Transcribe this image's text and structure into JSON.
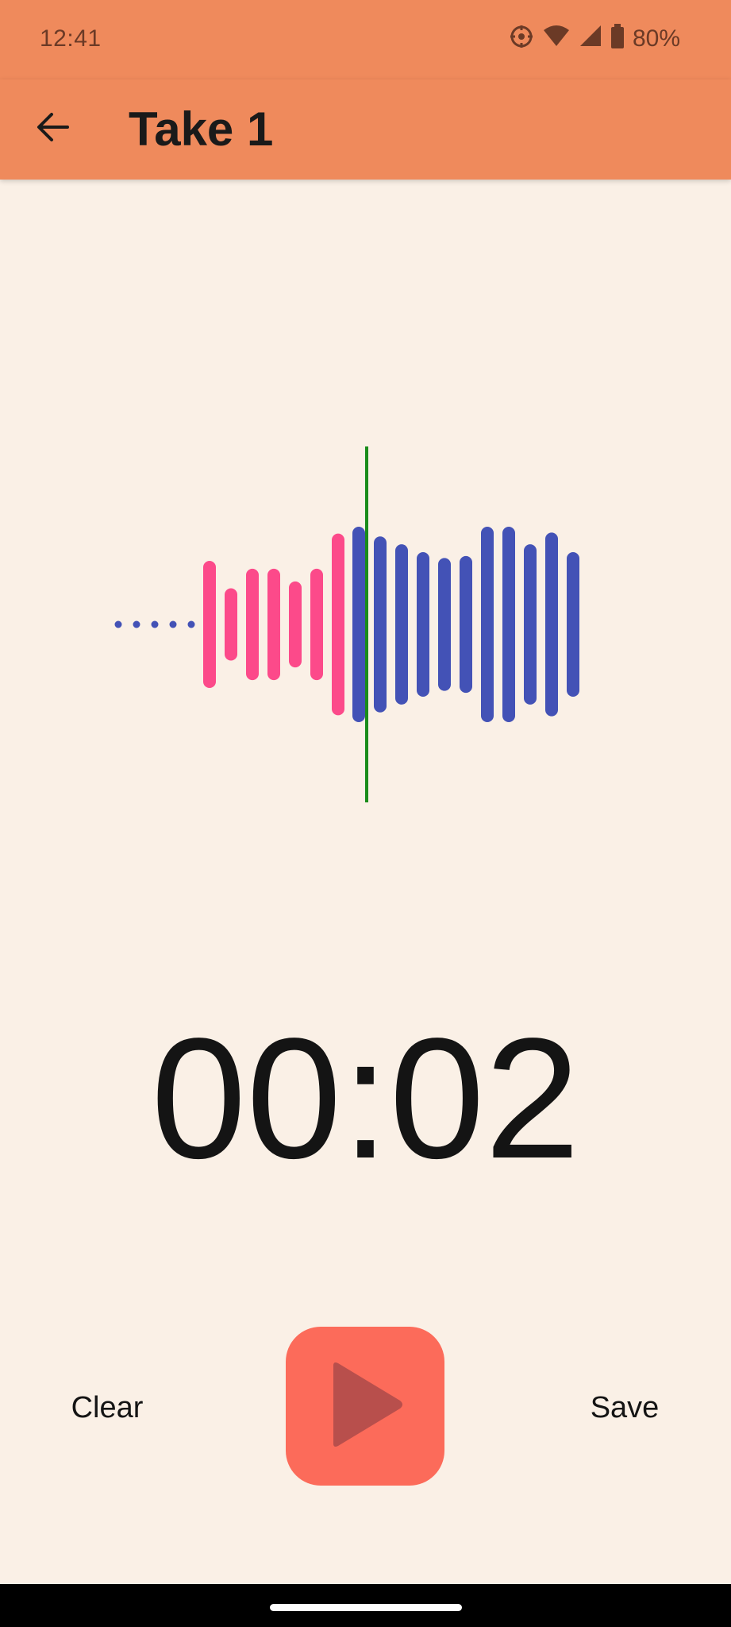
{
  "status_bar": {
    "time": "12:41",
    "battery_percent": "80%",
    "icons": [
      "sync-icon",
      "wifi-icon",
      "cellular-signal-icon",
      "battery-icon"
    ]
  },
  "app_bar": {
    "title": "Take 1",
    "back_icon": "arrow-back-icon"
  },
  "waveform": {
    "played_color": "#fc4a8a",
    "unplayed_color": "#4352b6",
    "playhead_color": "#1a8c1a",
    "played_levels": [
      0.65,
      0.37,
      0.57,
      0.57,
      0.44,
      0.57,
      0.93
    ],
    "unplayed_levels": [
      1.0,
      0.9,
      0.82,
      0.74,
      0.68,
      0.7,
      1.0,
      1.0,
      0.82,
      0.94,
      0.74
    ],
    "leading_dots": 5
  },
  "timer": {
    "elapsed": "00:02"
  },
  "controls": {
    "clear_label": "Clear",
    "save_label": "Save",
    "play_icon": "play-icon",
    "play_button_color": "#fc6b5a"
  }
}
